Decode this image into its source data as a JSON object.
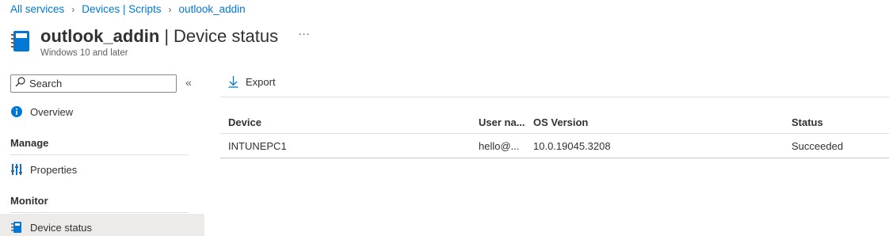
{
  "breadcrumb": {
    "items": [
      "All services",
      "Devices | Scripts",
      "outlook_addin"
    ],
    "separator": ">"
  },
  "header": {
    "name": "outlook_addin",
    "separator": "|",
    "section": "Device status",
    "subtitle": "Windows 10 and later",
    "more_label": "···"
  },
  "sidebar": {
    "search_placeholder": "Search",
    "collapse_label": "«",
    "overview_label": "Overview",
    "manage_heading": "Manage",
    "properties_label": "Properties",
    "monitor_heading": "Monitor",
    "device_status_label": "Device status"
  },
  "toolbar": {
    "export_label": "Export"
  },
  "table": {
    "columns": [
      "Device",
      "User na...",
      "OS Version",
      "Status"
    ],
    "rows": [
      [
        "INTUNEPC1",
        "hello@...",
        "10.0.19045.3208",
        "Succeeded"
      ]
    ]
  },
  "colors": {
    "accent": "#0078d4",
    "selected_bg": "#edebe9",
    "text": "#323130"
  },
  "icons": {
    "title": "script-document-icon",
    "search": "search-icon",
    "overview": "info-icon",
    "properties": "properties-sliders-icon",
    "device_status": "script-document-icon",
    "export": "download-arrow-icon"
  }
}
